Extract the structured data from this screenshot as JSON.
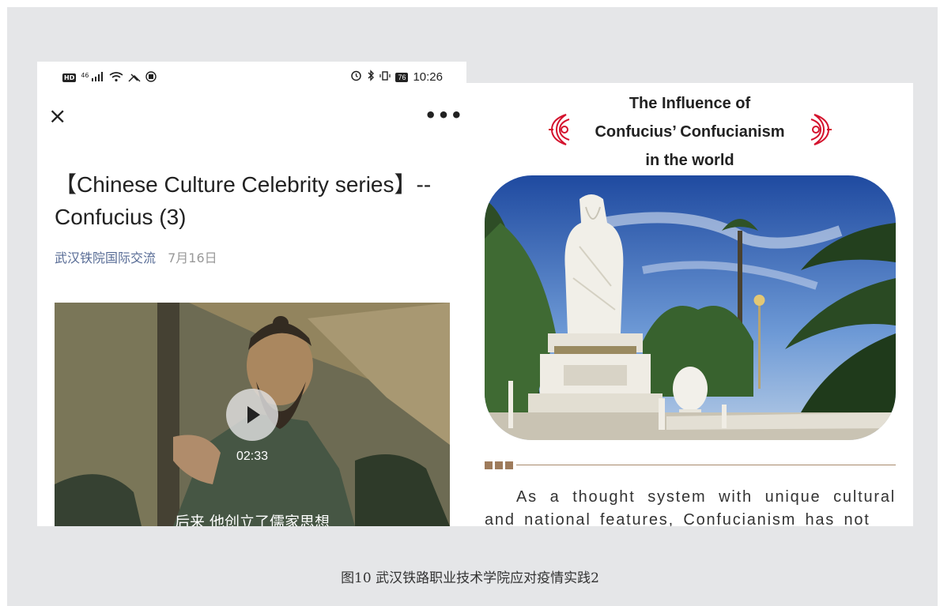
{
  "phone": {
    "status_time": "10:26",
    "battery": "76",
    "signal": "46",
    "close_icon": "×",
    "more_icon": "•••",
    "title": "【Chinese Culture Celebrity series】-- Confucius (3)",
    "author": "武汉铁院国际交流",
    "date": "7月16日",
    "video": {
      "duration": "02:33",
      "subtitle": "后来 他创立了儒家思想"
    }
  },
  "article": {
    "heading_line1": "The Influence of",
    "heading_line2": "Confucius’ Confucianism",
    "heading_line3": "in the world",
    "body": "As a thought system with unique cultural and national features, Confucianism has not"
  },
  "caption": "图10 武汉铁路职业技术学院应对疫情实践2",
  "colors": {
    "frame": "#e5e6e8",
    "ornament": "#d4122d",
    "author_link": "#576b95",
    "divider": "#a88a6c"
  }
}
